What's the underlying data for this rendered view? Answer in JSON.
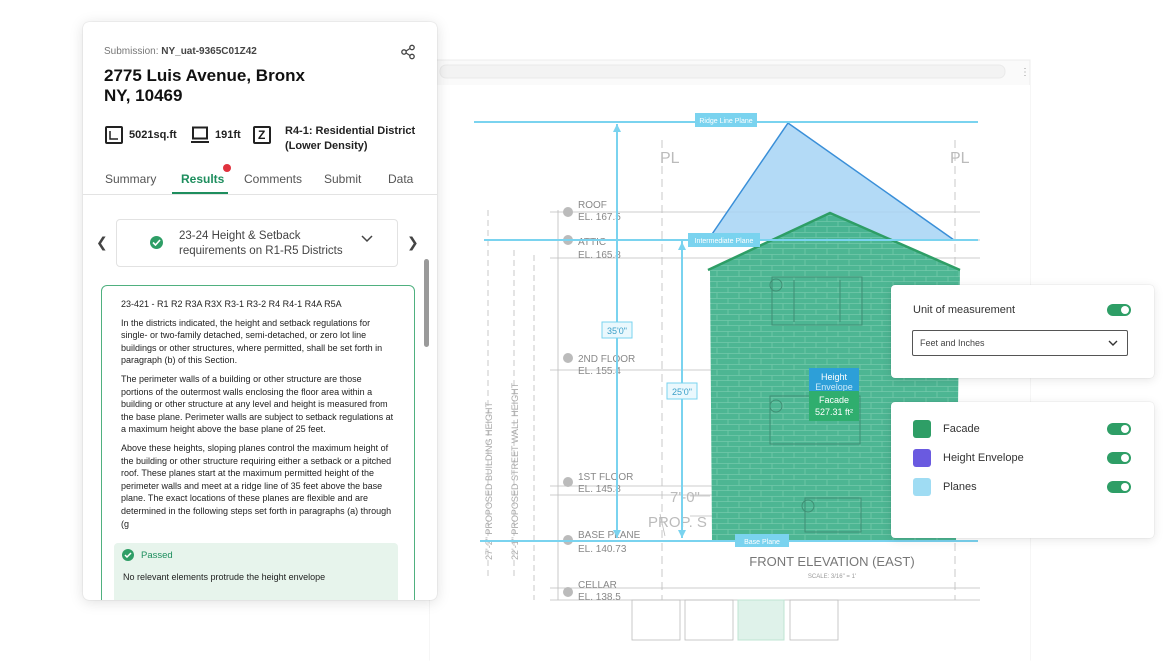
{
  "submission": {
    "label": "Submission:",
    "id": "NY_uat-9365C01Z42"
  },
  "address": {
    "line1": "2775 Luis Avenue, Bronx",
    "line2": "NY, 10469"
  },
  "meta": {
    "area": "5021sq.ft",
    "width": "191ft",
    "zone_line1": "R4-1: Residential District",
    "zone_line2": "(Lower Density)"
  },
  "tabs": [
    "Summary",
    "Results",
    "Comments",
    "Submit",
    "Data"
  ],
  "active_tab": "Results",
  "rule": {
    "line1": "23-24 Height & Setback",
    "line2": "requirements on R1-R5 Districts"
  },
  "content": {
    "heading": "23-421 - R1 R2 R3A R3X R3-1 R3-2 R4 R4-1 R4A R5A",
    "p1": "In the districts indicated, the height and setback regulations for single- or two-family detached, semi-detached, or zero lot line buildings or other structures, where permitted, shall be set forth in paragraph (b) of this Section.",
    "p2": "The perimeter walls of a building or other structure are those portions of the outermost walls enclosing the floor area within a building or other structure at any level and height is measured from the base plane. Perimeter walls are subject to setback regulations at a maximum height above the base plane of 25 feet.",
    "p3": "Above these heights, sloping planes control the maximum height of the building or other structure requiring either a setback or a pitched roof. These planes start at the maximum permitted height of the perimeter walls and meet at a ridge line of 35 feet above the base plane. The exact locations of these planes are flexible and are determined in the following steps set forth in paragraphs (a) through (g"
  },
  "passed": {
    "label": "Passed",
    "text": "No relevant elements protrude the height envelope"
  },
  "unit": {
    "title": "Unit of measurement",
    "selected": "Feet and Inches",
    "enabled": true
  },
  "layers": [
    {
      "label": "Facade",
      "color": "#2e9e66",
      "enabled": true
    },
    {
      "label": "Height Envelope",
      "color": "#6a5ae0",
      "enabled": true
    },
    {
      "label": "Planes",
      "color": "#9fdcf3",
      "enabled": true
    }
  ],
  "drawing": {
    "ridge_plane": "Ridge Line Plane",
    "intermediate_plane": "Intermediate Plane",
    "base_plane": "Base Plane",
    "dim_35": "35'0\"",
    "dim_25": "25'0\"",
    "height_tag": "Height",
    "height_tag_sub": "Envelope",
    "facade_tag": "Facade",
    "facade_area": "527.31 ft²",
    "elevation_title": "FRONT ELEVATION (EAST)",
    "scale_text": "SCALE: 3/16\" = 1'",
    "pl_left": "PL",
    "pl_right": "PL",
    "roof": "ROOF",
    "roof_el": "EL. 167.5",
    "attic": "ATTIC",
    "attic_el": "EL. 165.8",
    "second_floor": "2ND FLOOR",
    "second_el": "EL. 155.4",
    "first_floor": "1ST FLOOR",
    "first_el": "EL. 145.8",
    "base_plane_text": "BASE PLANE",
    "base_el": "EL. 140.73",
    "cellar": "CELLAR",
    "cellar_el": "EL. 138.5",
    "vert_label_1": "27'-2\" PROPOSED BUILDING HEIGHT",
    "vert_label_2": "22'-1\" PROPOSED STREET WALL HEIGHT",
    "prop_text": "PROP. S",
    "dim_bottom": "7'-0\""
  }
}
